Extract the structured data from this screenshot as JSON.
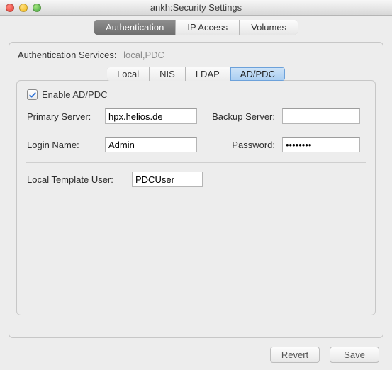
{
  "window": {
    "title": "ankh:Security Settings"
  },
  "mainTabs": {
    "authentication": "Authentication",
    "ipAccess": "IP Access",
    "volumes": "Volumes"
  },
  "authServices": {
    "label": "Authentication Services:",
    "value": "local,PDC"
  },
  "subTabs": {
    "local": "Local",
    "nis": "NIS",
    "ldap": "LDAP",
    "adpdc": "AD/PDC"
  },
  "form": {
    "enableLabel": "Enable AD/PDC",
    "enableChecked": true,
    "primaryServerLabel": "Primary Server:",
    "primaryServerValue": "hpx.helios.de",
    "backupServerLabel": "Backup Server:",
    "backupServerValue": "",
    "loginNameLabel": "Login Name:",
    "loginNameValue": "Admin",
    "passwordLabel": "Password:",
    "passwordValue": "••••••••",
    "localTemplateLabel": "Local Template User:",
    "localTemplateValue": "PDCUser"
  },
  "buttons": {
    "revert": "Revert",
    "save": "Save"
  },
  "colors": {
    "accentCheck": "#2a6fd6"
  }
}
